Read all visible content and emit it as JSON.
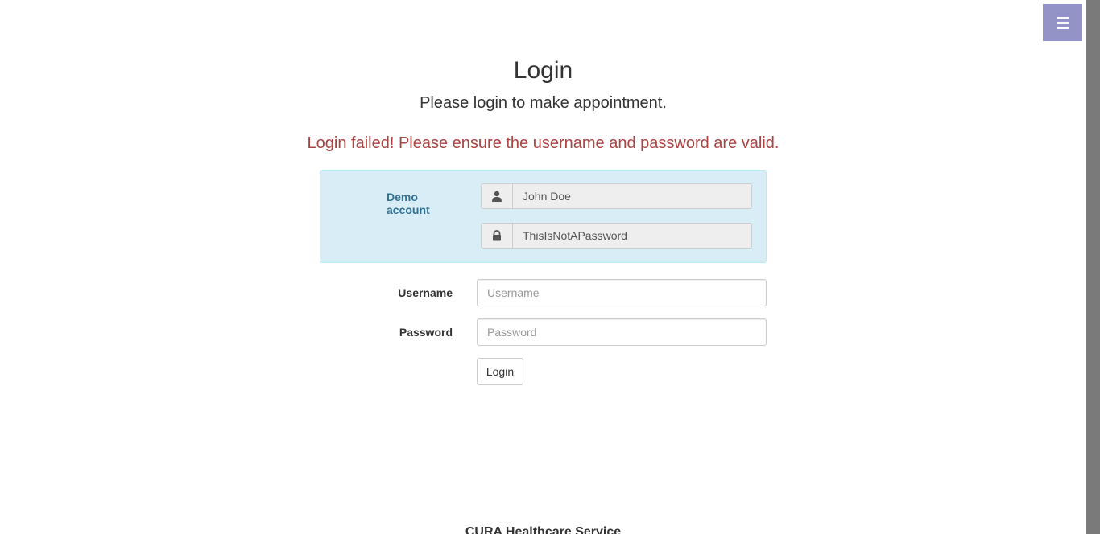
{
  "menu": {
    "toggle_icon": "hamburger-icon",
    "accent_color": "#9393c7"
  },
  "header": {
    "title": "Login",
    "subtitle": "Please login to make appointment."
  },
  "alert": {
    "message": "Login failed! Please ensure the username and password are valid.",
    "color": "#a94442"
  },
  "demo_account": {
    "label": "Demo account",
    "username_icon": "user-icon",
    "username": "John Doe",
    "password_icon": "lock-icon",
    "password": "ThisIsNotAPassword",
    "background_color": "#d9edf7"
  },
  "form": {
    "username_label": "Username",
    "username_placeholder": "Username",
    "username_value": "",
    "password_label": "Password",
    "password_placeholder": "Password",
    "password_value": "",
    "submit_label": "Login"
  },
  "footer": {
    "title": "CURA Healthcare Service"
  }
}
